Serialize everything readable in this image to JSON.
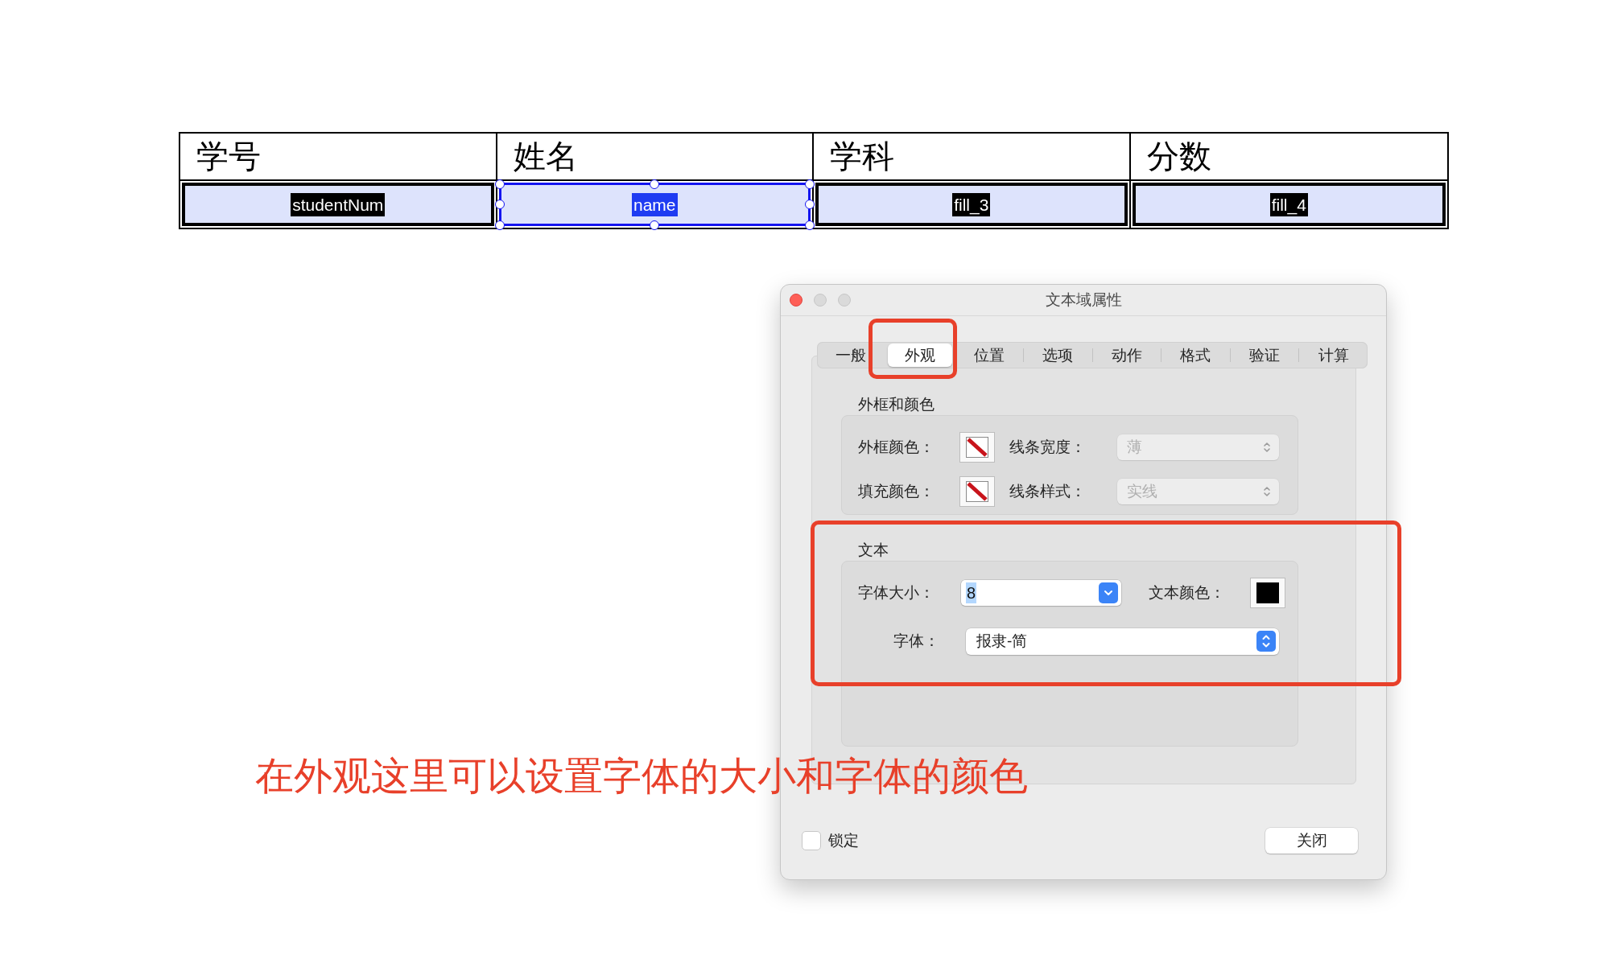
{
  "table": {
    "columns": [
      "学号",
      "姓名",
      "学科",
      "分数"
    ],
    "fields": [
      {
        "label": "studentNum",
        "selected": false
      },
      {
        "label": "name",
        "selected": true
      },
      {
        "label": "fill_3",
        "selected": false
      },
      {
        "label": "fill_4",
        "selected": false
      }
    ]
  },
  "dialog": {
    "title": "文本域属性",
    "tabs": [
      {
        "label": "一般",
        "selected": false,
        "highlighted": false
      },
      {
        "label": "外观",
        "selected": true,
        "highlighted": true
      },
      {
        "label": "位置",
        "selected": false,
        "highlighted": false
      },
      {
        "label": "选项",
        "selected": false,
        "highlighted": false
      },
      {
        "label": "动作",
        "selected": false,
        "highlighted": false
      },
      {
        "label": "格式",
        "selected": false,
        "highlighted": false
      },
      {
        "label": "验证",
        "selected": false,
        "highlighted": false
      },
      {
        "label": "计算",
        "selected": false,
        "highlighted": false
      }
    ],
    "border_section": {
      "title": "外框和颜色",
      "rows": [
        {
          "color_label": "外框颜色：",
          "swatch": {
            "empty": true
          },
          "option_label": "线条宽度：",
          "option": {
            "value": "薄",
            "disabled": true
          }
        },
        {
          "color_label": "填充颜色：",
          "swatch": {
            "empty": true
          },
          "option_label": "线条样式：",
          "option": {
            "value": "实线",
            "disabled": true
          }
        }
      ]
    },
    "text_section": {
      "title": "文本",
      "highlighted": true,
      "font_size": {
        "label": "字体大小：",
        "value": "8",
        "value_selected": true
      },
      "text_color": {
        "label": "文本颜色：",
        "swatch": {
          "empty": false,
          "color": "#000000"
        }
      },
      "font": {
        "label": "字体：",
        "value": "报隶-简",
        "disabled": false
      }
    },
    "lock": {
      "label": "锁定",
      "checked": false
    },
    "close_button": "关闭"
  },
  "annotation": "在外观这里可以设置字体的大小和字体的颜色"
}
